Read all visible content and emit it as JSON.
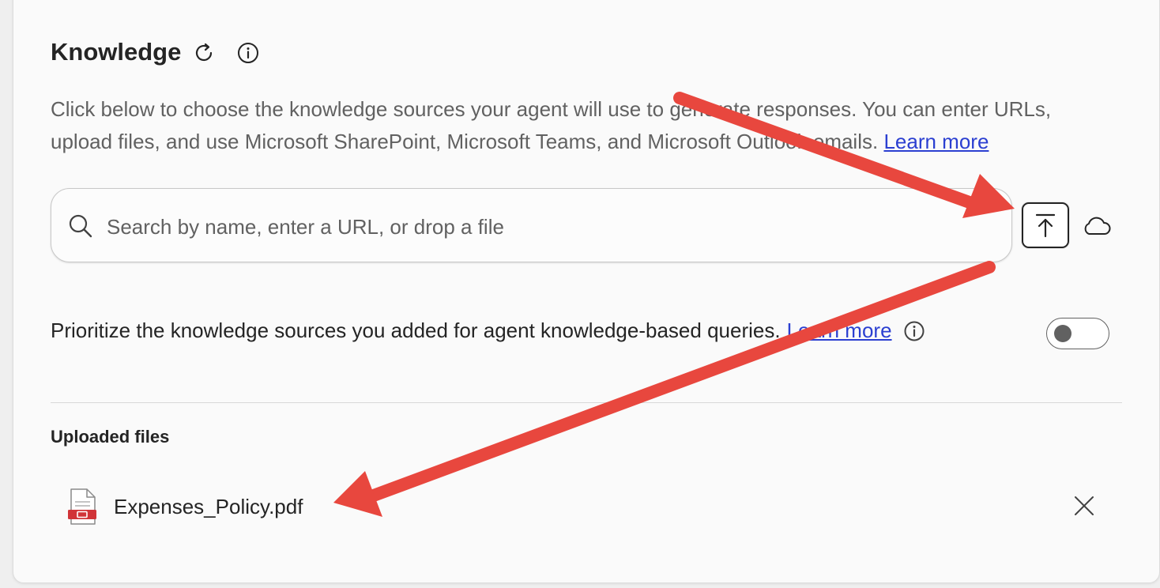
{
  "knowledge": {
    "title": "Knowledge",
    "description": "Click below to choose the knowledge sources your agent will use to generate responses. You can enter URLs, upload files, and use Microsoft SharePoint, Microsoft Teams, and Microsoft Outlook emails.",
    "learn_more_label": "Learn more"
  },
  "search": {
    "placeholder": "Search by name, enter a URL, or drop a file"
  },
  "prioritize": {
    "text": "Prioritize the knowledge sources you added for agent knowledge-based queries.",
    "learn_more_label": "Learn more",
    "toggle_on": false
  },
  "uploaded": {
    "section_title": "Uploaded files",
    "files": [
      {
        "name": "Expenses_Policy.pdf",
        "icon": "pdf-file-icon"
      }
    ]
  },
  "annotation_color": "#f0554a",
  "accent": "#2b3fd1"
}
